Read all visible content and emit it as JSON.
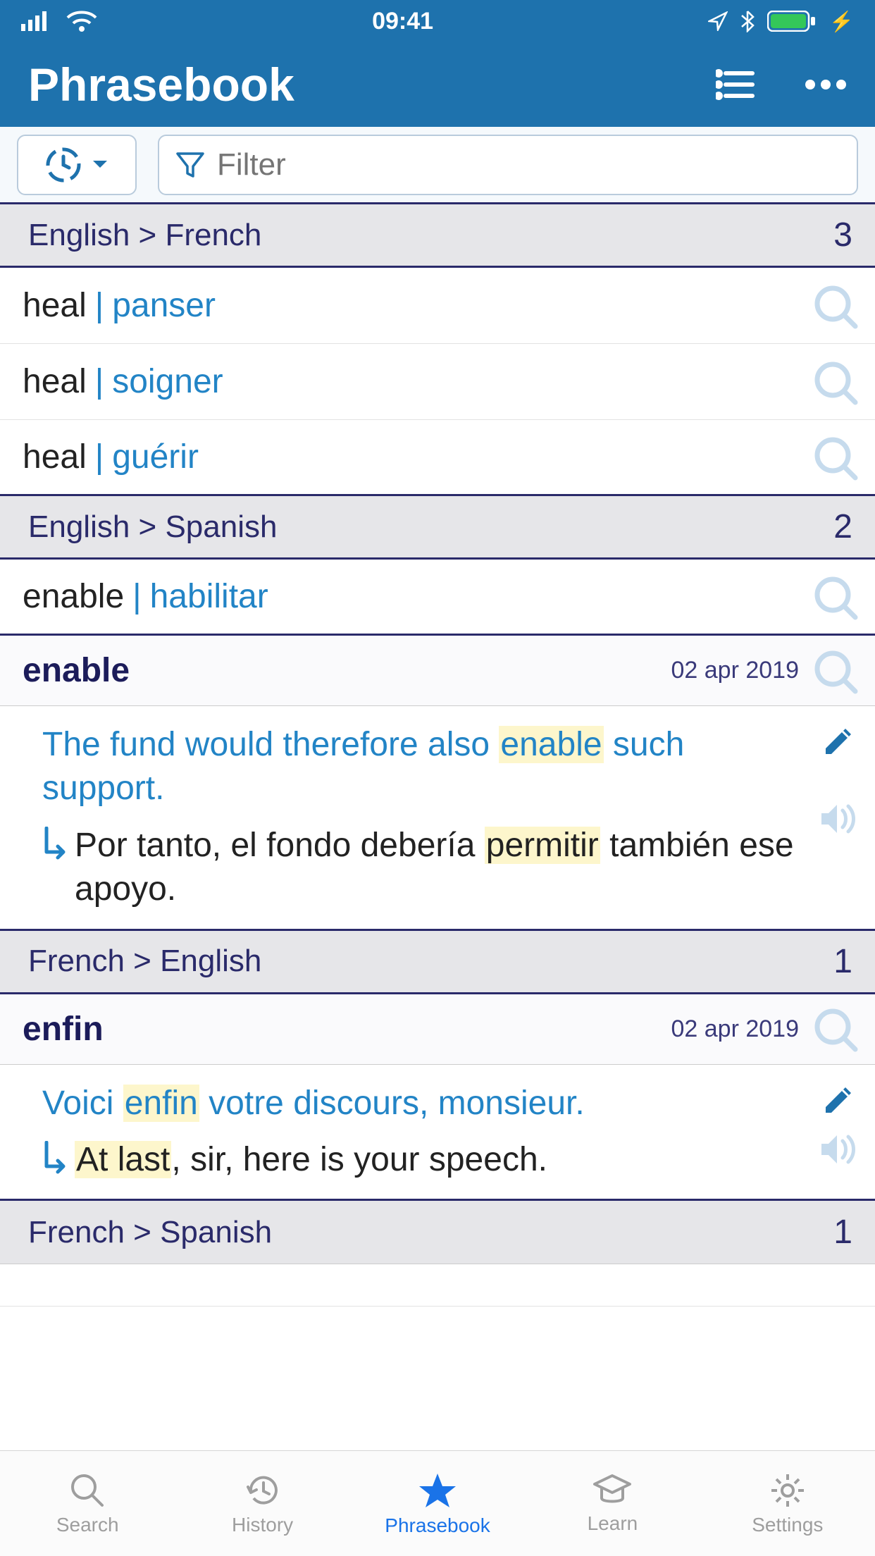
{
  "status": {
    "time": "09:41"
  },
  "nav": {
    "title": "Phrasebook"
  },
  "filter": {
    "placeholder": "Filter"
  },
  "sections": [
    {
      "title": "English > French",
      "count": "3",
      "entries": [
        {
          "source": "heal",
          "target": "panser"
        },
        {
          "source": "heal",
          "target": "soigner"
        },
        {
          "source": "heal",
          "target": "guérir"
        }
      ]
    },
    {
      "title": "English > Spanish",
      "count": "2",
      "entries": [
        {
          "source": "enable",
          "target": "habilitar"
        }
      ],
      "expanded": {
        "word": "enable",
        "date": "02 apr 2019",
        "example_src_pre": "The fund would therefore also ",
        "example_src_hl": "enable",
        "example_src_post": " such support.",
        "example_tgt_pre": "Por tanto, el fondo debería ",
        "example_tgt_hl": "permitir",
        "example_tgt_post": " también ese apoyo."
      }
    },
    {
      "title": "French > English",
      "count": "1",
      "expanded": {
        "word": "enfin",
        "date": "02 apr 2019",
        "example_src_pre": "Voici ",
        "example_src_hl": "enfin",
        "example_src_post": " votre discours, monsieur.",
        "example_tgt_pre": "",
        "example_tgt_hl": "At last",
        "example_tgt_post": ", sir, here is your speech."
      }
    },
    {
      "title": "French > Spanish",
      "count": "1"
    }
  ],
  "tabs": {
    "search": "Search",
    "history": "History",
    "phrasebook": "Phrasebook",
    "learn": "Learn",
    "settings": "Settings"
  }
}
